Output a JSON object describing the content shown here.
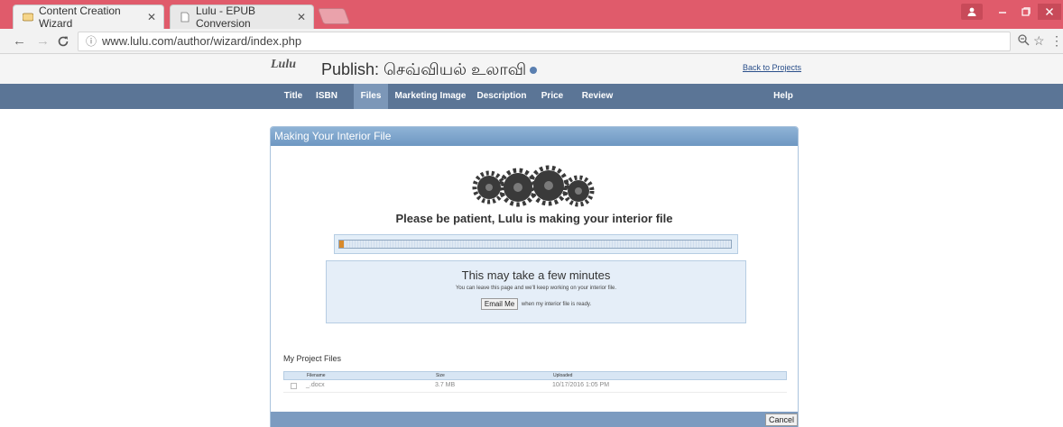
{
  "browser": {
    "tabs": [
      {
        "title": "Content Creation Wizard",
        "icon": "lulu-favicon",
        "active": true
      },
      {
        "title": "Lulu - EPUB Conversion",
        "icon": "page-icon",
        "active": false
      }
    ],
    "close_glyph": "✕",
    "url": "www.lulu.com/author/wizard/index.php",
    "info_glyph": "ⓘ"
  },
  "header": {
    "logo": "Lulu",
    "title": "Publish: செவ்வியல் உலாவி",
    "back_link": "Back to Projects"
  },
  "nav": {
    "items": [
      {
        "label": "Title",
        "active": false
      },
      {
        "label": "ISBN",
        "active": false
      },
      {
        "label": "Files",
        "active": true
      },
      {
        "label": "Marketing Image",
        "active": false
      },
      {
        "label": "Description",
        "active": false
      },
      {
        "label": "Price",
        "active": false
      },
      {
        "label": "Review",
        "active": false
      },
      {
        "label": "Help",
        "active": false
      }
    ]
  },
  "panel": {
    "heading": "Making Your Interior File",
    "patient_message": "Please be patient, Lulu is making your interior file",
    "progress_fraction": 0.012,
    "info_title": "This may take a few minutes",
    "info_sub": "You can leave this page and we'll keep working on your interior file.",
    "email_button": "Email Me",
    "email_suffix": "when my interior file is ready.",
    "files_title": "My Project Files",
    "columns": [
      "Filename",
      "Size",
      "Uploaded"
    ],
    "files": [
      {
        "name": "_.docx",
        "size": "3.7 MB",
        "uploaded": "10/17/2016 1:05 PM"
      }
    ],
    "cancel_button": "Cancel"
  },
  "colors": {
    "titlebar": "#e05b6b",
    "nav": "#5b7596",
    "progress_fill": "#d88a2b"
  }
}
